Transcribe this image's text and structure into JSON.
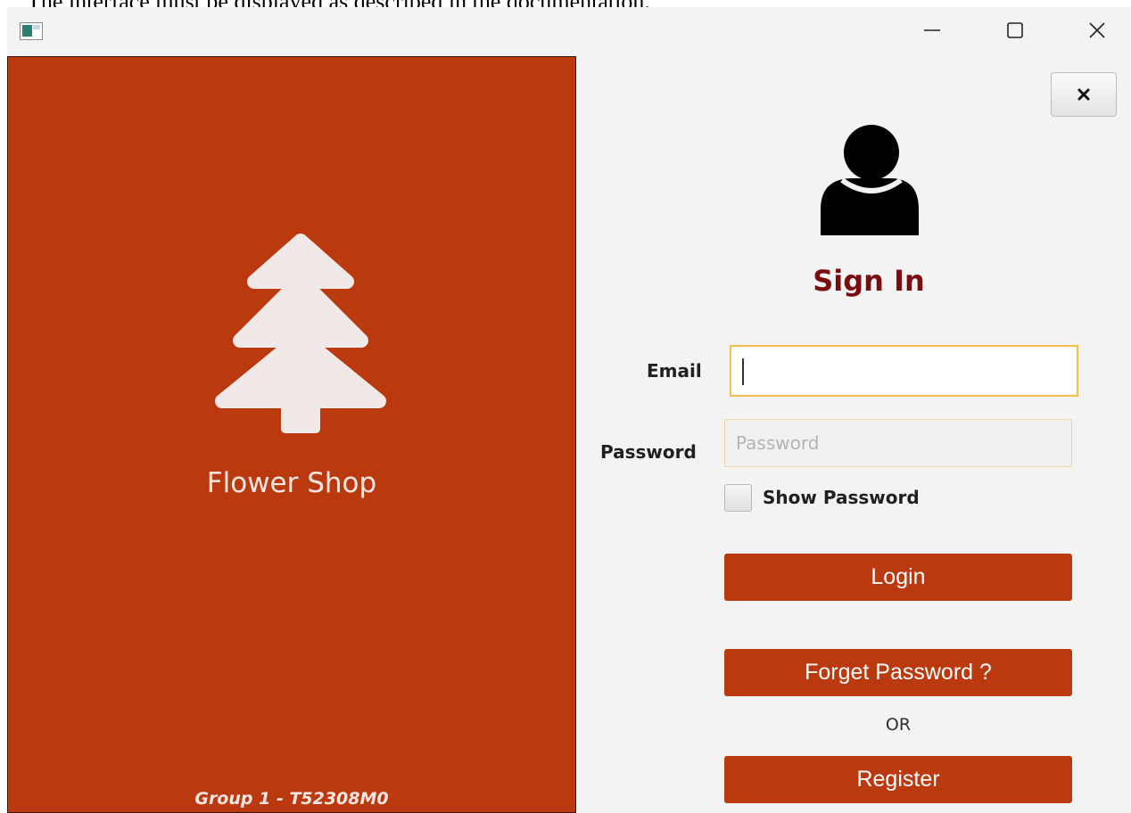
{
  "document": {
    "caption": "The interface must be displayed as described in the documentation."
  },
  "window": {
    "icon": "app-window-icon",
    "controls": {
      "minimize": "minimize-icon",
      "maximize": "maximize-icon",
      "close": "close-icon"
    }
  },
  "brand": {
    "icon": "pine-tree-icon",
    "name": "Flower Shop",
    "footer": "Group 1 - T52308M0",
    "color": "#bb390e"
  },
  "form": {
    "dismiss_icon": "close-icon",
    "avatar_icon": "user-icon",
    "title": "Sign In",
    "title_color": "#7a0d12",
    "email_label": "Email",
    "email_value": "",
    "password_label": "Password",
    "password_placeholder": "Password",
    "show_password_label": "Show Password",
    "show_password_checked": false,
    "login_label": "Login",
    "forget_label": "Forget Password ?",
    "or_label": "OR",
    "register_label": "Register",
    "focus_color": "#f2c14b"
  }
}
